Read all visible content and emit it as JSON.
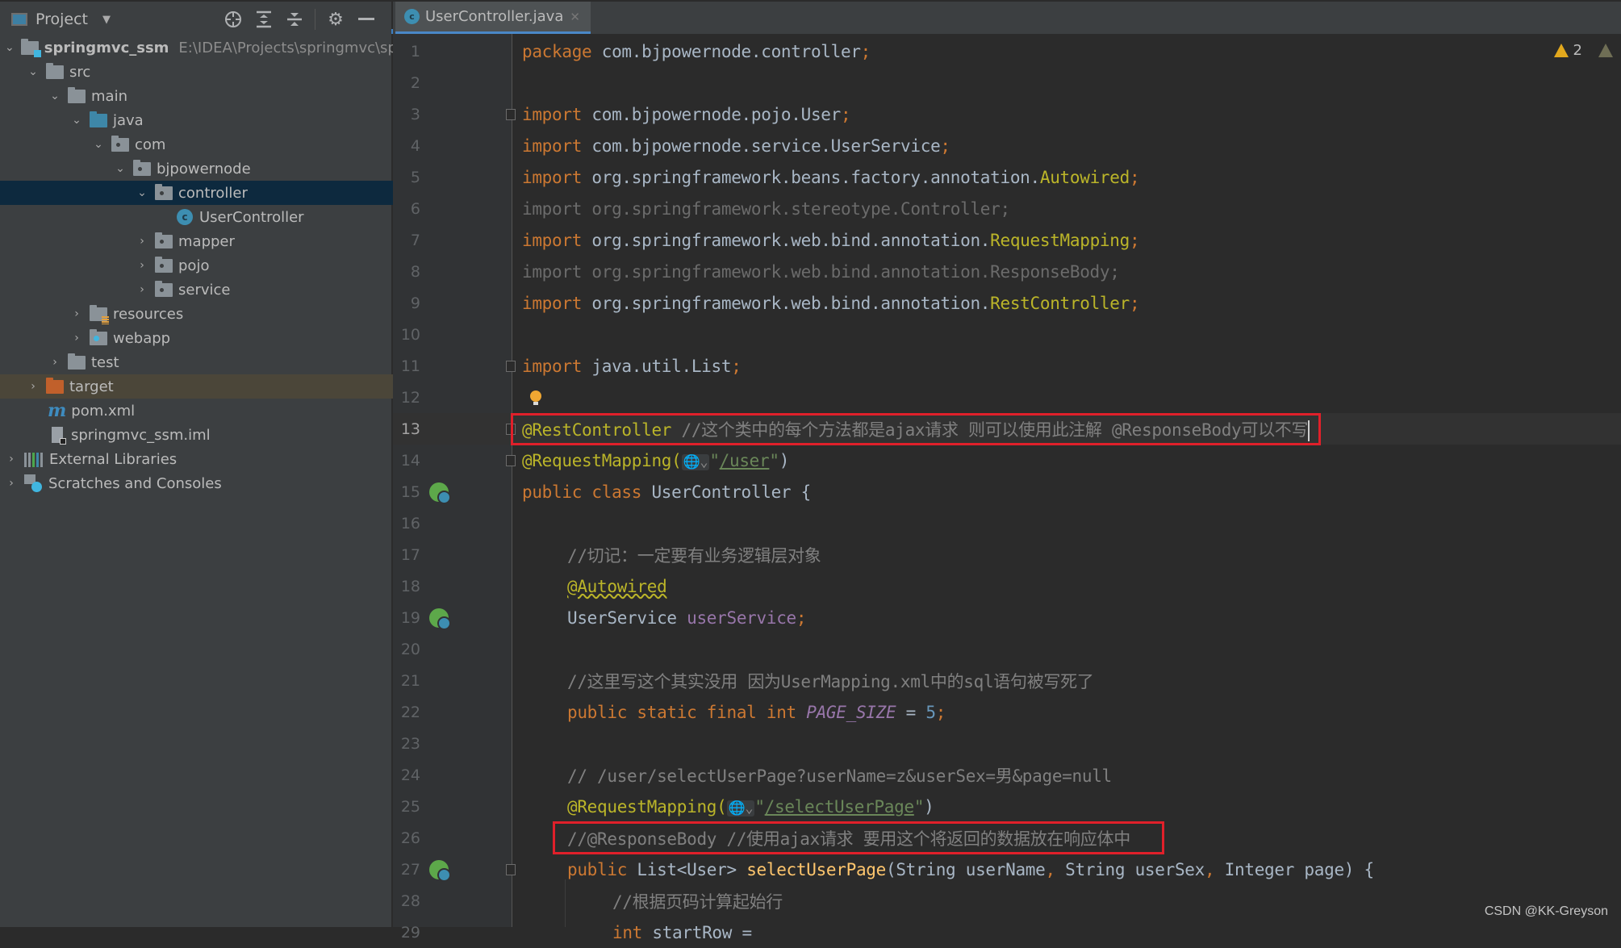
{
  "sidebar": {
    "title": "Project",
    "tools": [
      "locate-icon",
      "expand-all-icon",
      "collapse-all-icon",
      "gear-icon",
      "minimize-icon"
    ],
    "tree": [
      {
        "label": "springmvc_ssm",
        "path": "E:\\IDEA\\Projects\\springmvc\\spri",
        "expanded": true
      },
      {
        "label": "src",
        "expanded": true
      },
      {
        "label": "main",
        "expanded": true
      },
      {
        "label": "java",
        "expanded": true
      },
      {
        "label": "com",
        "expanded": true
      },
      {
        "label": "bjpowernode",
        "expanded": true
      },
      {
        "label": "controller",
        "expanded": true,
        "selected": true
      },
      {
        "label": "UserController"
      },
      {
        "label": "mapper",
        "expanded": false
      },
      {
        "label": "pojo",
        "expanded": false
      },
      {
        "label": "service",
        "expanded": false
      },
      {
        "label": "resources",
        "expanded": false
      },
      {
        "label": "webapp",
        "expanded": false
      },
      {
        "label": "test",
        "expanded": false
      },
      {
        "label": "target",
        "expanded": false
      },
      {
        "label": "pom.xml"
      },
      {
        "label": "springmvc_ssm.iml"
      },
      {
        "label": "External Libraries",
        "expanded": false
      },
      {
        "label": "Scratches and Consoles",
        "expanded": false
      }
    ]
  },
  "editor": {
    "tab": {
      "label": "UserController.java",
      "icon_letter": "c"
    },
    "warnings_count": "2",
    "current_line": 13,
    "line_numbers": [
      "1",
      "2",
      "3",
      "4",
      "5",
      "6",
      "7",
      "8",
      "9",
      "10",
      "11",
      "12",
      "13",
      "14",
      "15",
      "16",
      "17",
      "18",
      "19",
      "20",
      "21",
      "22",
      "23",
      "24",
      "25",
      "26",
      "27",
      "28",
      "29"
    ],
    "lines": {
      "l1": {
        "kw": "package",
        "text": " com.bjpowernode.controller",
        "semi": ";"
      },
      "l3": {
        "kw": "import",
        "text": " com.bjpowernode.pojo.User",
        "semi": ";"
      },
      "l4": {
        "kw": "import",
        "text": " com.bjpowernode.service.UserService",
        "semi": ";"
      },
      "l5": {
        "kw": "import",
        "text": " org.springframework.beans.factory.annotation.",
        "ann": "Autowired",
        "semi": ";"
      },
      "l6": {
        "text": "import org.springframework.stereotype.Controller;"
      },
      "l7": {
        "kw": "import",
        "text": " org.springframework.web.bind.annotation.",
        "ann": "RequestMapping",
        "semi": ";"
      },
      "l8": {
        "text": "import org.springframework.web.bind.annotation.ResponseBody;"
      },
      "l9": {
        "kw": "import",
        "text": " org.springframework.web.bind.annotation.",
        "ann": "RestController",
        "semi": ";"
      },
      "l11": {
        "kw": "import",
        "text": " java.util.List",
        "semi": ";"
      },
      "l13": {
        "ann": "@RestController",
        "comment": " //这个类中的每个方法都是ajax请求 则可以使用此注解 @ResponseBody可以不写"
      },
      "l14": {
        "ann": "@RequestMapping",
        "open": "(",
        "globe": "🌐⌄",
        "q1": "\"",
        "url": "/user",
        "q2": "\"",
        "close": ")"
      },
      "l15": {
        "kw": "public class",
        "text": " UserController {"
      },
      "l17": {
        "comment": "//切记：一定要有业务逻辑层对象"
      },
      "l18": {
        "ann": "@Autowired"
      },
      "l19": {
        "text": "UserService ",
        "field": "userService",
        "semi": ";"
      },
      "l21": {
        "comment": "//这里写这个其实没用 因为UserMapping.xml中的sql语句被写死了"
      },
      "l22": {
        "kw": "public static final int",
        "field": "PAGE_SIZE",
        "eq": " = ",
        "num": "5",
        "semi": ";"
      },
      "l24": {
        "comment": "// /user/selectUserPage?userName=z&userSex=男&page=null"
      },
      "l25": {
        "ann": "@RequestMapping",
        "open": "(",
        "globe": "🌐⌄",
        "q1": "\"",
        "url": "/selectUserPage",
        "q2": "\"",
        "close": ")"
      },
      "l26": {
        "comment": "//@ResponseBody //使用ajax请求 要用这个将返回的数据放在响应体中"
      },
      "l27": {
        "kw": "public",
        "text1": " List<User> ",
        "method": "selectUserPage",
        "text2": "(String userName",
        "c1": ",",
        "text3": " String userSex",
        "c2": ",",
        "text4": " Integer page) {"
      },
      "l28": {
        "comment": "//根据页码计算起始行"
      },
      "l29": {
        "kw": "int",
        "text": " startRow = "
      }
    }
  },
  "watermark": "CSDN @KK-Greyson",
  "colors": {
    "keyword": "#cc7832",
    "annotation": "#bbb529",
    "comment": "#808080",
    "string": "#6a8757",
    "field": "#9876aa",
    "number": "#6897bb",
    "highlight_box": "#e0202a",
    "selection": "#0d293e"
  }
}
